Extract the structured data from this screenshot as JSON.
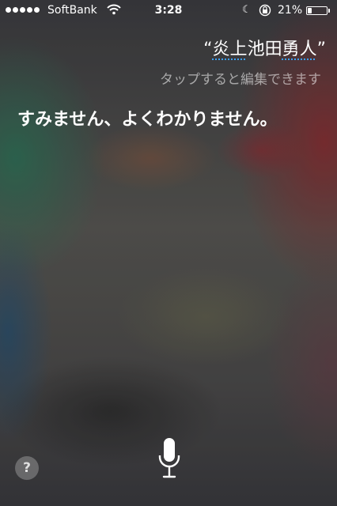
{
  "status_bar": {
    "carrier": "SoftBank",
    "time": "3:28",
    "battery_percent": "21%",
    "battery_level": 0.21,
    "signal_bars": 5,
    "icons": [
      "signal-dots",
      "wifi-icon",
      "moon-icon",
      "rotation-lock-icon",
      "battery-icon"
    ]
  },
  "siri": {
    "query_open_quote": "“",
    "query_part1": "炎上",
    "query_part2": "池田",
    "query_part3": "勇人",
    "query_close_quote": "”",
    "edit_hint": "タップすると編集できます",
    "response": "すみません、よくわかりません。"
  },
  "controls": {
    "help_label": "?",
    "mic_icon": "microphone-icon"
  },
  "colors": {
    "underline_accent": "#3aa0ff",
    "text": "#ffffff"
  }
}
